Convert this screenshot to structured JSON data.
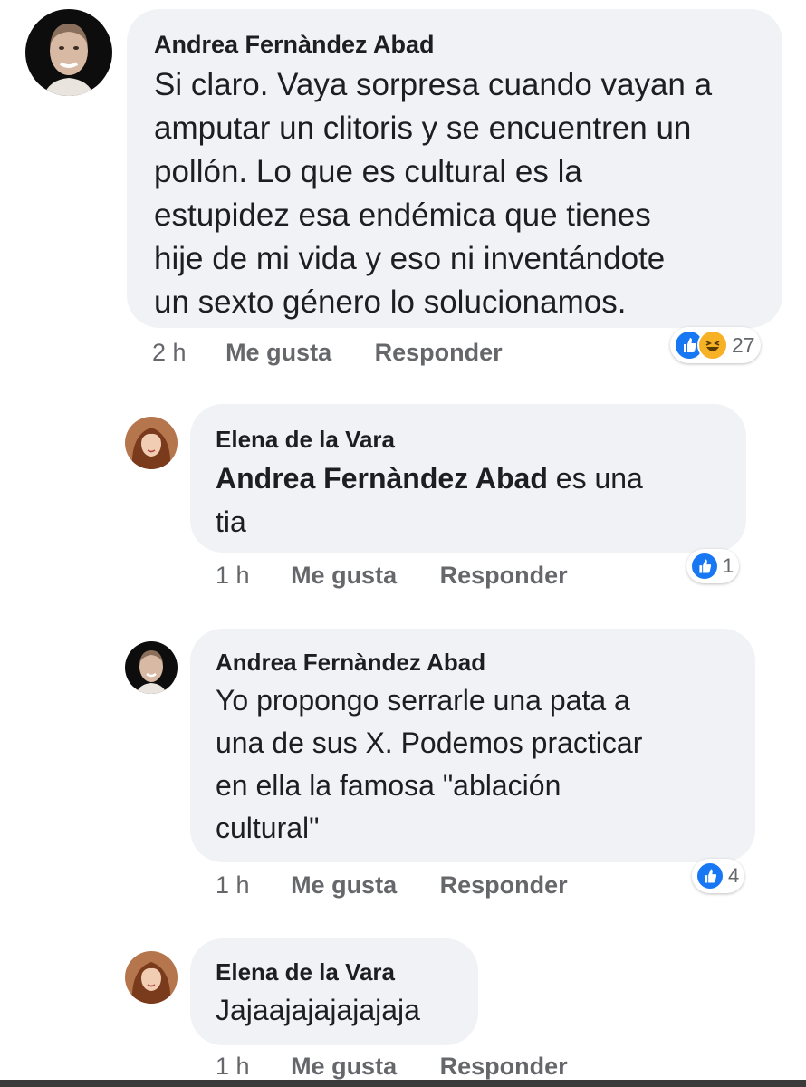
{
  "comments": [
    {
      "author": "Andrea Fernàndez Abad",
      "lines": [
        "Si claro. Vaya sorpresa cuando vayan a",
        "amputar un clitoris y se encuentren un",
        "pollón. Lo que es cultural es la",
        "estupidez esa endémica que tienes",
        "hije de mi vida y eso ni inventándote",
        "un sexto género lo solucionamos."
      ],
      "time": "2 h",
      "like_label": "Me gusta",
      "reply_label": "Responder",
      "reaction_count": "27",
      "reaction_icons": [
        "like-icon",
        "haha-icon"
      ]
    },
    {
      "author": "Elena de la Vara",
      "mention": "Andrea Fernàndez Abad",
      "mention_rest": " es una",
      "line2": "tia",
      "time": "1 h",
      "like_label": "Me gusta",
      "reply_label": "Responder",
      "reaction_count": "1",
      "reaction_icons": [
        "like-icon"
      ]
    },
    {
      "author": "Andrea Fernàndez Abad",
      "lines": [
        "Yo propongo serrarle una pata a",
        "una de sus X. Podemos practicar",
        "en ella la famosa \"ablación",
        "cultural\""
      ],
      "time": "1 h",
      "like_label": "Me gusta",
      "reply_label": "Responder",
      "reaction_count": "4",
      "reaction_icons": [
        "like-icon"
      ]
    },
    {
      "author": "Elena de la Vara",
      "lines": [
        "Jajaajajajajajaja"
      ],
      "time": "1 h",
      "like_label": "Me gusta",
      "reply_label": "Responder"
    }
  ],
  "colors": {
    "bubble": "#f0f2f5",
    "like_blue": "#1877f2",
    "haha_yellow": "#f7b125",
    "meta_gray": "#65676b"
  }
}
